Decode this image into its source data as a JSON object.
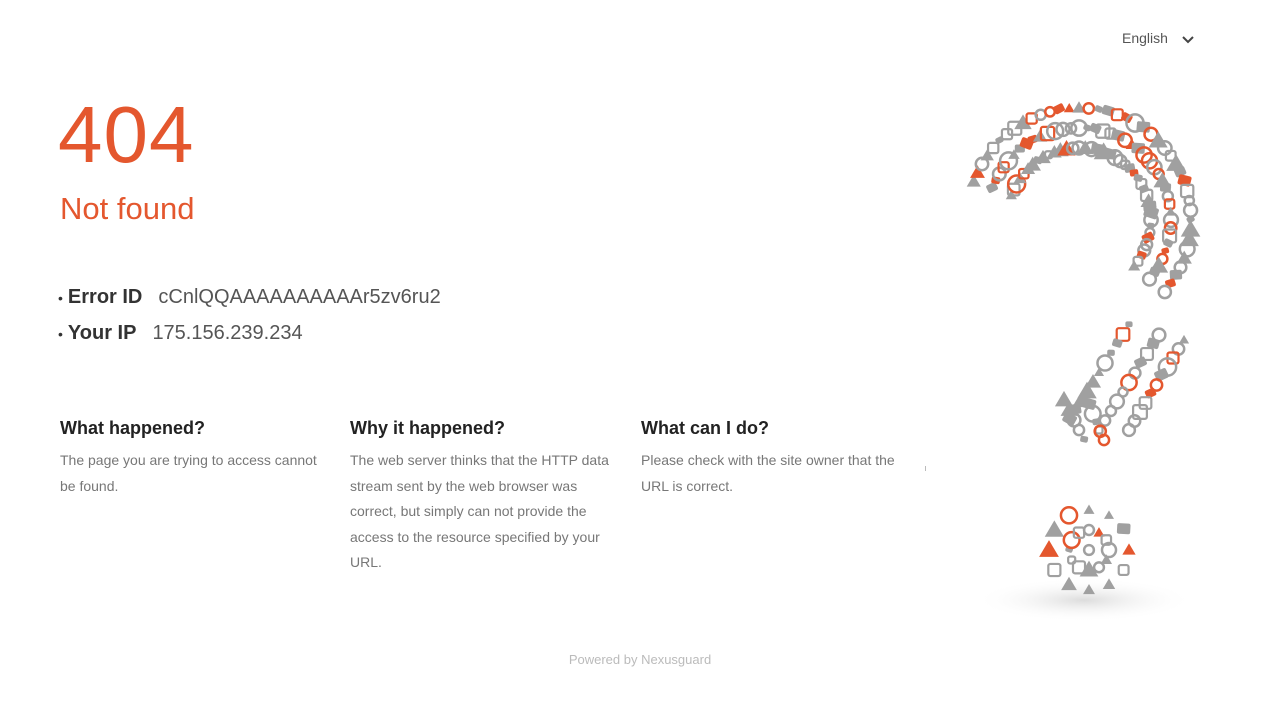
{
  "language": {
    "selected": "English"
  },
  "error": {
    "code": "404",
    "status": "Not found"
  },
  "details": {
    "error_id": {
      "label": "Error ID",
      "value": "cCnlQQAAAAAAAAAAr5zv6ru2"
    },
    "your_ip": {
      "label": "Your IP",
      "value": "175.156.239.234"
    }
  },
  "sections": [
    {
      "title": "What happened?",
      "text": "The page you are trying to access cannot be found."
    },
    {
      "title": "Why it happened?",
      "text": "The web server thinks that the HTTP data stream sent by the web browser was correct, but simply can not provide the access to the resource specified by your URL."
    },
    {
      "title": "What can I do?",
      "text": "Please check with the site owner that the URL is correct."
    }
  ],
  "footer": {
    "text": "Powered by Nexusguard"
  },
  "colors": {
    "accent": "#e4572e",
    "icon_gray": "#a0a0a0"
  },
  "illustration": {
    "icon": "question-mark-icon-collage"
  }
}
